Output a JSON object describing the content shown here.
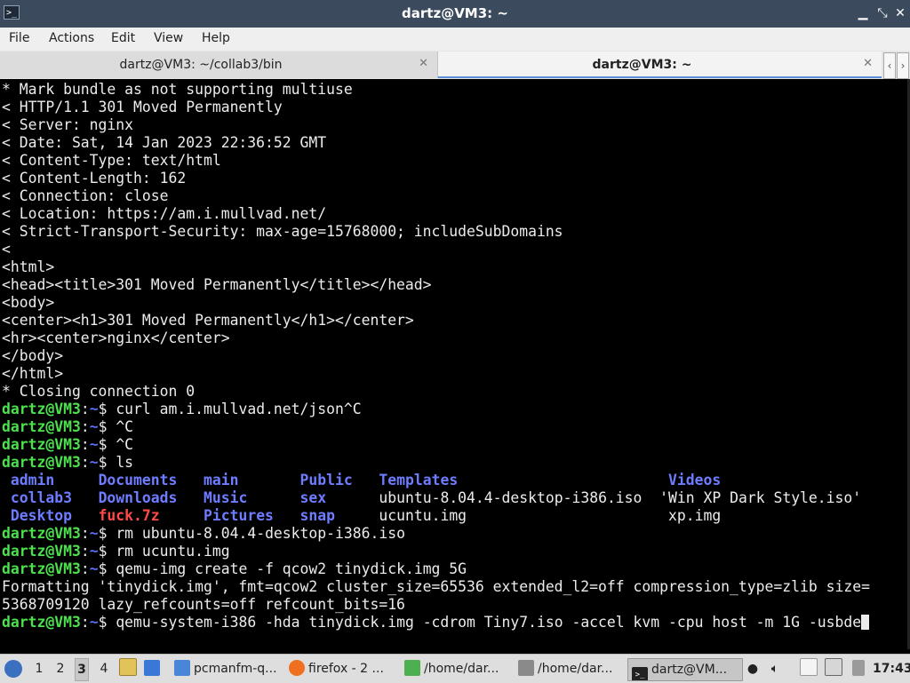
{
  "window": {
    "title": "dartz@VM3: ~"
  },
  "menu": [
    "File",
    "Actions",
    "Edit",
    "View",
    "Help"
  ],
  "tabs": [
    {
      "label": "dartz@VM3: ~/collab3/bin",
      "active": false
    },
    {
      "label": "dartz@VM3: ~",
      "active": true
    }
  ],
  "terminal": {
    "plain_lines": [
      "* Mark bundle as not supporting multiuse",
      "< HTTP/1.1 301 Moved Permanently",
      "< Server: nginx",
      "< Date: Sat, 14 Jan 2023 22:36:52 GMT",
      "< Content-Type: text/html",
      "< Content-Length: 162",
      "< Connection: close",
      "< Location: https://am.i.mullvad.net/",
      "< Strict-Transport-Security: max-age=15768000; includeSubDomains",
      "<",
      "<html>",
      "<head><title>301 Moved Permanently</title></head>",
      "<body>",
      "<center><h1>301 Moved Permanently</h1></center>",
      "<hr><center>nginx</center>",
      "</body>",
      "</html>",
      "* Closing connection 0"
    ],
    "prompt": {
      "user": "dartz@VM3",
      "sep": ":",
      "path": "~",
      "symbol": "$ "
    },
    "commands": [
      "curl am.i.mullvad.net/json^C",
      "^C",
      "^C",
      "ls"
    ],
    "ls_rows": [
      [
        {
          "t": "admin",
          "k": "dir"
        },
        {
          "t": "Documents",
          "k": "dir"
        },
        {
          "t": "main",
          "k": "dir"
        },
        {
          "t": "Public",
          "k": "dir"
        },
        {
          "t": "Templates",
          "k": "dir"
        },
        {
          "t": "Videos",
          "k": "dir"
        }
      ],
      [
        {
          "t": "collab3",
          "k": "dir"
        },
        {
          "t": "Downloads",
          "k": "dir"
        },
        {
          "t": "Music",
          "k": "dir"
        },
        {
          "t": "sex",
          "k": "dir"
        },
        {
          "t": "ubuntu-8.04.4-desktop-i386.iso",
          "k": "file"
        },
        {
          "t": "'Win XP Dark Style.iso'",
          "k": "file"
        }
      ],
      [
        {
          "t": "Desktop",
          "k": "dir"
        },
        {
          "t": "fuck.7z",
          "k": "arc"
        },
        {
          "t": "Pictures",
          "k": "dir"
        },
        {
          "t": "snap",
          "k": "dir"
        },
        {
          "t": "ucuntu.img",
          "k": "file"
        },
        {
          "t": "xp.img",
          "k": "file"
        }
      ]
    ],
    "after_ls": [
      "rm ubuntu-8.04.4-desktop-i386.iso",
      "rm ucuntu.img",
      "qemu-img create -f qcow2 tinydick.img 5G"
    ],
    "output_lines": [
      "Formatting 'tinydick.img', fmt=qcow2 cluster_size=65536 extended_l2=off compression_type=zlib size=",
      "5368709120 lazy_refcounts=off refcount_bits=16"
    ],
    "last_command": "qemu-system-i386 -hda tinydick.img -cdrom Tiny7.iso -accel kvm -cpu host -m 1G -usbde"
  },
  "taskbar": {
    "workspaces": [
      "1",
      "2",
      "3",
      "4"
    ],
    "active_workspace": "3",
    "tasks": [
      {
        "label": "pcmanfm-q...",
        "icon": "folder-icon",
        "active": false
      },
      {
        "label": "firefox - 2 ...",
        "icon": "firefox-icon",
        "active": false
      },
      {
        "label": "/home/dar...",
        "icon": "text-editor-icon",
        "active": false
      },
      {
        "label": "/home/dar...",
        "icon": "document-icon",
        "active": false
      },
      {
        "label": "dartz@VM...",
        "icon": "terminal-icon",
        "active": true
      }
    ],
    "clock": "17:43"
  },
  "colors": {
    "prompt_user": "#4de04d",
    "prompt_path": "#5b6ff2",
    "directory": "#6e7cff",
    "archive": "#ff4a4a",
    "titlebar": "#3c4a5d"
  }
}
